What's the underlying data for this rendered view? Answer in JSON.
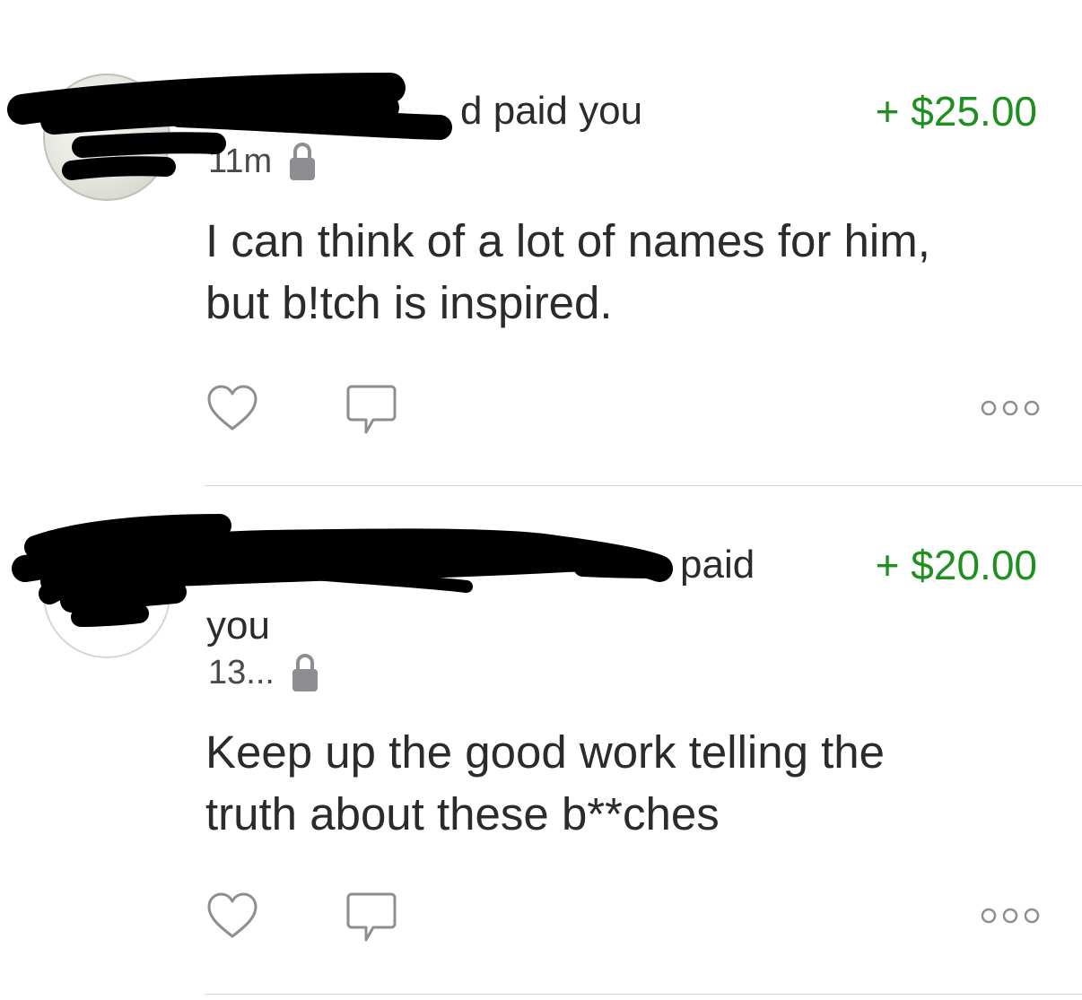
{
  "colors": {
    "amount_positive": "#1f8f1f",
    "text_primary": "#2b2b2e",
    "icon_gray": "#8d8d92",
    "divider": "#d4d4d6"
  },
  "feed": [
    {
      "headline_suffix": "d paid you",
      "amount": "+ $25.00",
      "time": "11m",
      "privacy_icon": "lock-icon",
      "message_lines": [
        "I can think of a lot of names for him,",
        "but b!tch is inspired."
      ],
      "actions": [
        "heart-icon",
        "comment-icon",
        "more-icon"
      ]
    },
    {
      "headline_suffix": "paid",
      "headline_continuation": "you",
      "amount": "+ $20.00",
      "time": "13...",
      "privacy_icon": "lock-icon",
      "message_lines": [
        "Keep up the good work telling the",
        "truth about these b**ches"
      ],
      "actions": [
        "heart-icon",
        "comment-icon",
        "more-icon"
      ]
    }
  ]
}
